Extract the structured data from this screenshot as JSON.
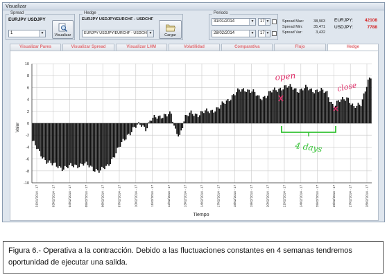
{
  "window": {
    "title": "Visualizar"
  },
  "spread": {
    "group_label": "Spread",
    "pair_text": "EURJPY USDJPY",
    "select_value": "1",
    "button_label": "Visualizar",
    "button_icon": "magnifier-document-icon"
  },
  "hedge": {
    "group_label": "Hedge",
    "pair_text": "EURJPY USDJPY/EURCHF - USDCHF",
    "select_value": "EURJPY USDJPY/EURCHF - USDCHF",
    "button_label": "Cargar",
    "button_icon": "folder-icon"
  },
  "periodo": {
    "group_label": "Periodo",
    "start_date": "31/01/2014",
    "start_hour": "17",
    "end_date": "28/02/2014",
    "end_hour": "17"
  },
  "stats": [
    {
      "label": "Spread Max:",
      "value": "38,903"
    },
    {
      "label": "Spread Min:",
      "value": "35,471"
    },
    {
      "label": "Spread Var:",
      "value": "3,432"
    }
  ],
  "positions": [
    {
      "label": "EURJPY:",
      "value": "42108"
    },
    {
      "label": "USDJPY:",
      "value": "7788"
    }
  ],
  "tabs": [
    {
      "label": "Visualizar Pares",
      "active": false
    },
    {
      "label": "Visualizar Spread",
      "active": false
    },
    {
      "label": "Visualizar LHM",
      "active": false
    },
    {
      "label": "Volatilidad",
      "active": false
    },
    {
      "label": "Comparativa",
      "active": false
    },
    {
      "label": "Flujo",
      "active": false
    },
    {
      "label": "Hedge",
      "active": true
    }
  ],
  "chart_data": {
    "type": "bar",
    "xlabel": "Tiempo",
    "ylabel": "Valor",
    "ylim": [
      -10,
      10
    ],
    "yticks": [
      -10,
      -8,
      -6,
      -4,
      -2,
      0,
      2,
      4,
      6,
      8,
      10
    ],
    "grid": true,
    "xticks": [
      "31/01/2014 - 17",
      "03/02/2014 - 17",
      "04/02/2014 - 17",
      "05/02/2014 - 17",
      "06/02/2014 - 17",
      "07/02/2014 - 17",
      "10/02/2014 - 17",
      "11/02/2014 - 17",
      "12/02/2014 - 17",
      "13/02/2014 - 17",
      "14/02/2014 - 17",
      "17/02/2014 - 17",
      "18/02/2014 - 17",
      "19/02/2014 - 17",
      "20/02/2014 - 17",
      "21/02/2014 - 17",
      "24/02/2014 - 17",
      "25/02/2014 - 17",
      "26/02/2014 - 17",
      "27/02/2014 - 17",
      "28/02/2014 - 17"
    ],
    "anchors": [
      [
        0,
        -3.0
      ],
      [
        2,
        -5.0
      ],
      [
        4,
        -6.2
      ],
      [
        6,
        -7.0
      ],
      [
        9,
        -7.5
      ],
      [
        12,
        -7.2
      ],
      [
        15,
        -6.8
      ],
      [
        18,
        -7.6
      ],
      [
        20,
        -8.0
      ],
      [
        22,
        -7.4
      ],
      [
        24,
        -5.5
      ],
      [
        26,
        -3.8
      ],
      [
        28,
        -2.0
      ],
      [
        30,
        -0.8
      ],
      [
        32,
        -0.2
      ],
      [
        33.5,
        -0.8
      ],
      [
        35,
        0.6
      ],
      [
        37,
        1.0
      ],
      [
        39,
        1.5
      ],
      [
        41,
        1.4
      ],
      [
        42,
        -1.0
      ],
      [
        43.5,
        -2.0
      ],
      [
        45,
        0.8
      ],
      [
        47,
        1.8
      ],
      [
        49,
        1.5
      ],
      [
        51,
        1.9
      ],
      [
        53,
        2.2
      ],
      [
        55,
        2.5
      ],
      [
        57,
        3.6
      ],
      [
        59,
        4.6
      ],
      [
        61,
        5.4
      ],
      [
        63,
        5.8
      ],
      [
        65,
        5.3
      ],
      [
        67,
        4.3
      ],
      [
        69,
        4.6
      ],
      [
        71,
        5.4
      ],
      [
        73,
        5.9
      ],
      [
        75,
        6.1
      ],
      [
        77,
        6.0
      ],
      [
        79,
        5.5
      ],
      [
        81,
        5.9
      ],
      [
        83,
        5.6
      ],
      [
        85,
        5.4
      ],
      [
        87,
        5.2
      ],
      [
        89,
        2.8
      ],
      [
        91,
        3.8
      ],
      [
        93,
        4.5
      ],
      [
        95,
        2.5
      ],
      [
        97,
        3.2
      ],
      [
        99,
        7.0
      ],
      [
        100,
        7.6
      ]
    ]
  },
  "annotations": {
    "open": "open",
    "close": "close",
    "days": "4 days"
  },
  "caption": {
    "text": "Figura 6.- Operativa a la contracción. Debido a las fluctuaciones constantes en 4 semanas tendremos oportunidad de ejecutar una salida."
  }
}
